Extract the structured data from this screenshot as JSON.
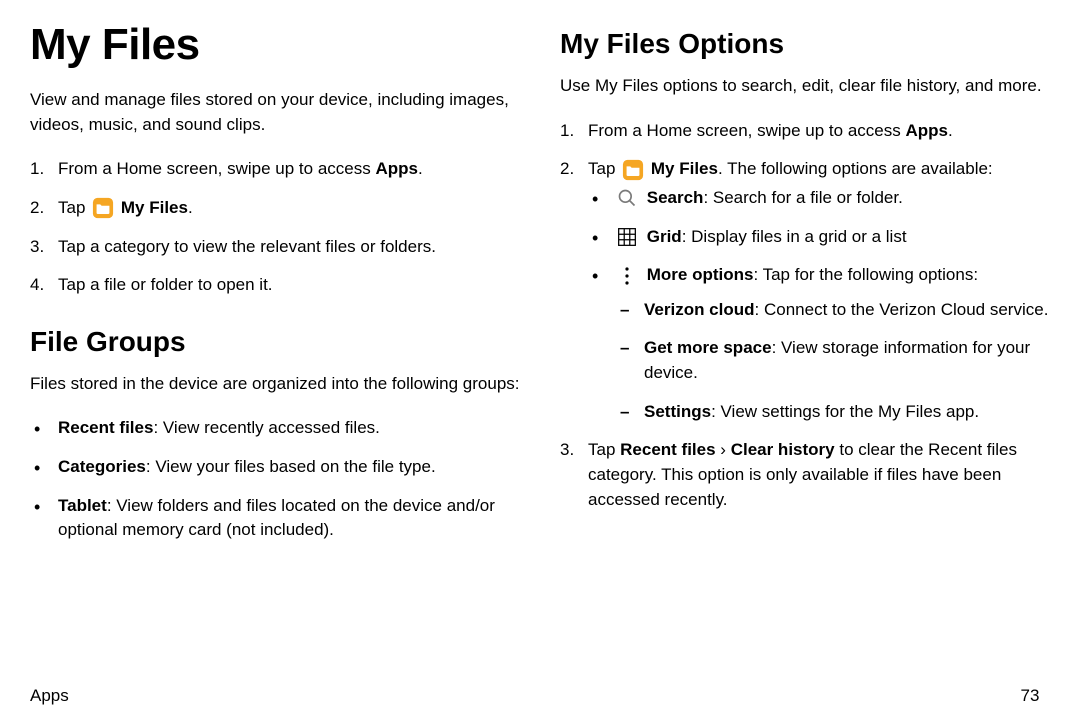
{
  "left": {
    "title": "My Files",
    "intro": "View and manage files stored on your device, including images, videos, music, and sound clips.",
    "steps": {
      "s1_a": "From a Home screen, swipe up to access ",
      "s1_b": "Apps",
      "s1_c": ".",
      "s2_a": "Tap ",
      "s2_icon": "folder-icon",
      "s2_b": " My Files",
      "s2_c": ".",
      "s3": "Tap a category to view the relevant files or folders.",
      "s4": "Tap a file or folder to open it."
    },
    "groups": {
      "title": "File Groups",
      "intro": "Files stored in the device are organized into the following groups:",
      "items": {
        "i1_b": "Recent files",
        "i1_r": ": View recently accessed files.",
        "i2_b": "Categories",
        "i2_r": ": View your files based on the file type.",
        "i3_b": "Tablet",
        "i3_r": ": View folders and files located on the device and/or optional memory card (not included)."
      }
    }
  },
  "right": {
    "title": "My Files Options",
    "intro": "Use My Files options to search, edit, clear file history, and more.",
    "steps": {
      "s1_a": "From a Home screen, swipe up to access ",
      "s1_b": "Apps",
      "s1_c": ".",
      "s2_a": "Tap ",
      "s2_icon": "folder-icon",
      "s2_b": " My Files",
      "s2_c": ". The following options are available:",
      "opt1_icon": "search-icon",
      "opt1_b": "Search",
      "opt1_r": ": Search for a file or folder.",
      "opt2_icon": "grid-icon",
      "opt2_b": "Grid",
      "opt2_r": ": Display files in a grid or a list",
      "opt3_icon": "more-icon",
      "opt3_b": "More options",
      "opt3_r": ": Tap for the following options:",
      "sub1_b": "Verizon cloud",
      "sub1_r": ": Connect to the Verizon Cloud service.",
      "sub2_b": "Get more space",
      "sub2_r": ": View storage information for your device.",
      "sub3_b": "Settings",
      "sub3_r": ": View settings for the My Files app.",
      "s3_a": "Tap ",
      "s3_b": "Recent files",
      "s3_c": " › ",
      "s3_d": "Clear history",
      "s3_e": " to clear the Recent files category. This option is only available if files have been accessed recently."
    }
  },
  "footer": {
    "section": "Apps",
    "page": "73"
  },
  "colors": {
    "folder_bg": "#f5a623",
    "folder_fg": "#ffffff"
  }
}
